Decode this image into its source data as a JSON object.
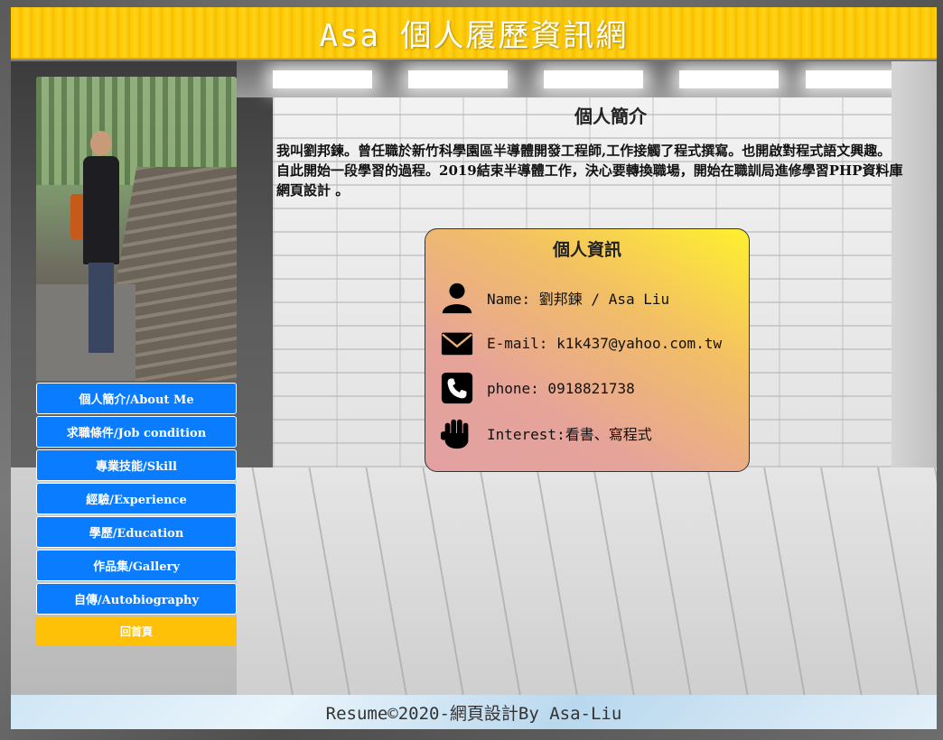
{
  "header": {
    "title": "Asa 個人履歷資訊網"
  },
  "sidebar": {
    "photo_alt": "",
    "nav": [
      {
        "label": "個人簡介/About Me"
      },
      {
        "label": "求職條件/Job condition"
      },
      {
        "label": "專業技能/Skill"
      },
      {
        "label": "經驗/Experience"
      },
      {
        "label": "學歷/Education"
      },
      {
        "label": "作品集/Gallery"
      },
      {
        "label": "自傳/Autobiography"
      }
    ],
    "home_label": "回首頁"
  },
  "intro": {
    "title": "個人簡介",
    "body": "我叫劉邦鍊。曾任職於新竹科學園區半導體開發工程師,工作接觸了程式撰寫。也開啟對程式語文興趣。 自此開始一段學習的過程。2019結束半導體工作，決心要轉換職場，開始在職訓局進修學習PHP資料庫網頁設計 。"
  },
  "info": {
    "title": "個人資訊",
    "name": "Name: 劉邦鍊 / Asa Liu",
    "email": "E-mail: k1k437@yahoo.com.tw",
    "phone": "phone: 0918821738",
    "interest": "Interest:看書、寫程式"
  },
  "footer": {
    "text": "Resume©2020-網頁設計By Asa-Liu"
  },
  "colors": {
    "nav": "#0a7cff",
    "home": "#ffc107",
    "header": "#ffc800"
  }
}
